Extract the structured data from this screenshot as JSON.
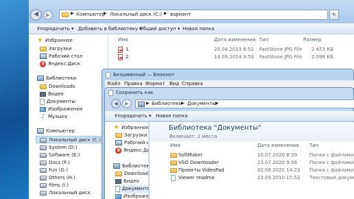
{
  "explorer": {
    "address": [
      "Компьютер",
      "Локальный диск (C:)",
      "вариант"
    ],
    "toolbar": [
      "Упорядочить",
      "Добавить в библиотеку",
      "Общий доступ",
      "Новая папка"
    ],
    "columns": [
      "Имя",
      "Дата изменения",
      "Тип",
      "Размер"
    ],
    "files": [
      {
        "name": "1",
        "date": "20.04.2013 8:52",
        "type": "FastStone JPG File",
        "size": "2 453 КБ"
      },
      {
        "name": "2",
        "date": "14.09.2014 9:58",
        "type": "FastStone JPG File",
        "size": "2 098 КБ"
      }
    ],
    "nav": {
      "favorites": "Избранное",
      "favorites_items": [
        "Загрузки",
        "Рабочий стол",
        "Яндекс.Диск"
      ],
      "libraries": "Библиотеки",
      "libraries_items": [
        "Downloads",
        "Видео",
        "Документы",
        "Изображения",
        "Музыка"
      ],
      "computer": "Компьютер",
      "drives": [
        "Локальный диск (C:)",
        "System (D:)",
        "Software (E:)",
        "Docs (F:)",
        "Fun (G:)",
        "Others (H:)",
        "films (I:)",
        "Локальный диск"
      ]
    }
  },
  "notepad": {
    "title": "Безымянный — Блокнот",
    "menu": [
      "Файл",
      "Правка",
      "Формат",
      "Вид",
      "Справка"
    ]
  },
  "save_dialog": {
    "title": "Сохранить как",
    "address": [
      "Библиотеки",
      "Документы"
    ],
    "toolbar": [
      "Упорядочить",
      "Новая папка"
    ],
    "library_title": "Библиотека \"Документы\"",
    "library_sub": "Включает: 2 места",
    "columns": [
      "Имя",
      "Дата изменения",
      "Тип"
    ],
    "files": [
      {
        "name": "SoftMaker",
        "date": "10.07.2020 8:39",
        "type": "Папка с файлами"
      },
      {
        "name": "VSO Downloader",
        "date": "23.07.2020 9:06",
        "type": "Папка с файлами"
      },
      {
        "name": "Проекты VideoPad",
        "date": "02.08.2020 14:23",
        "type": "Папка с файлами"
      },
      {
        "name": "Viewer readme",
        "date": "23.09.2010 15:52",
        "type": "Текстовый документ"
      }
    ],
    "nav": {
      "favorites": "Избранное",
      "favorites_items": [
        "Загрузки",
        "Рабочий стол",
        "Яндекс.Диск"
      ],
      "libraries": "Библиотеки",
      "libraries_items": [
        "Downloads",
        "Видео",
        "Документы",
        "Изображения"
      ]
    }
  }
}
